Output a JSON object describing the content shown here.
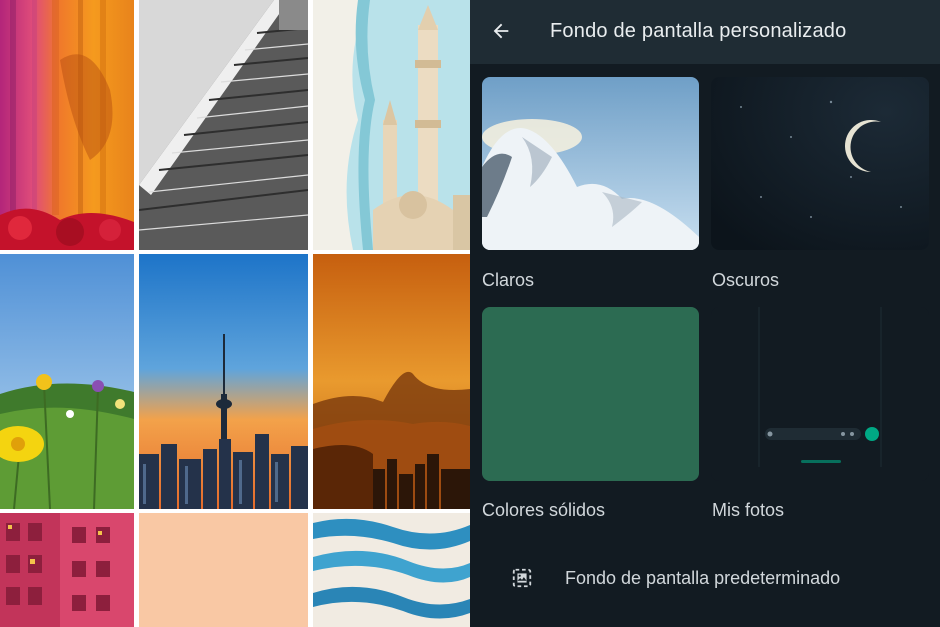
{
  "header": {
    "title": "Fondo de pantalla personalizado",
    "back_icon": "arrow-left-icon"
  },
  "categories": [
    {
      "label": "Claros"
    },
    {
      "label": "Oscuros"
    },
    {
      "label": "Colores sólidos"
    },
    {
      "label": "Mis fotos"
    }
  ],
  "default_option": {
    "label": "Fondo de pantalla predeterminado",
    "icon": "image-placeholder-icon"
  },
  "colors": {
    "app_background": "#121b22",
    "app_bar": "#1f2c34",
    "title_text": "#e9edef",
    "label_text": "#d1d7db",
    "solid_color_swatch": "#2c6b52",
    "accent": "#00a884"
  }
}
